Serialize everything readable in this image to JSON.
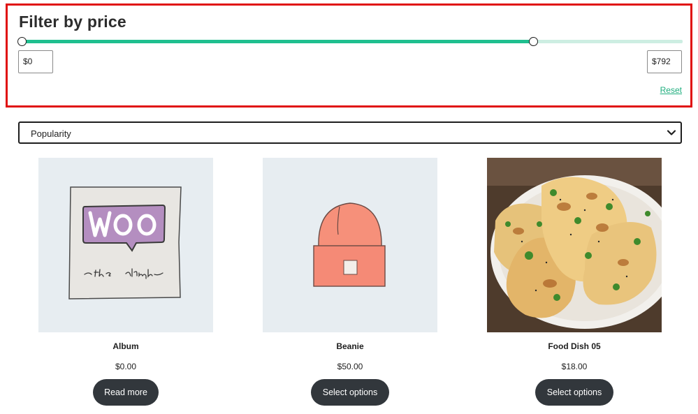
{
  "filter": {
    "title": "Filter by price",
    "min_value": "$0",
    "max_value": "$792",
    "range_min_fraction": 0.0,
    "range_max_fraction": 0.774,
    "reset_label": "Reset",
    "colors": {
      "track": "#cdeee2",
      "fill": "#1fbf8f",
      "border": "#e01010"
    }
  },
  "sort": {
    "selected": "Popularity",
    "chevron_icon": "chevron-down-icon"
  },
  "products": [
    {
      "name": "Album",
      "price": "$0.00",
      "button": "Read more",
      "image": "woo-album-illustration"
    },
    {
      "name": "Beanie",
      "price": "$50.00",
      "button": "Select options",
      "image": "beanie-illustration"
    },
    {
      "name": "Food Dish 05",
      "price": "$18.00",
      "button": "Select options",
      "image": "naan-photo"
    }
  ],
  "button_color": "#32373c"
}
